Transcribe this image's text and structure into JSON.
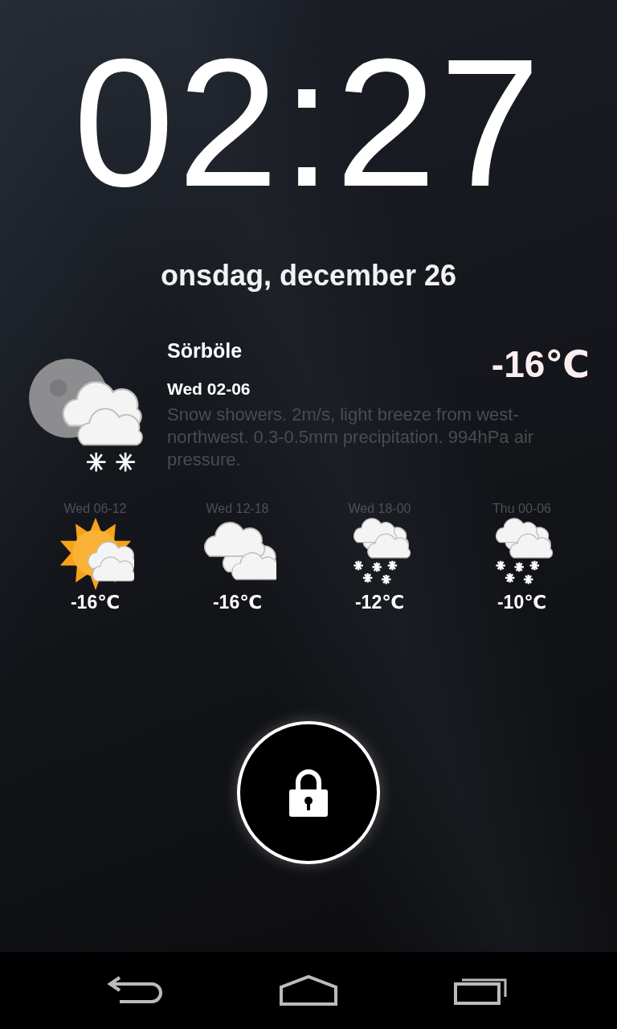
{
  "clock": {
    "time": "02:27"
  },
  "date": "onsdag, december 26",
  "current": {
    "kind": "moon-snow",
    "location": "Sörböle",
    "temperature": "-16℃",
    "period": "Wed 02-06",
    "description": "Snow showers. 2m/s, light breeze from west-northwest. 0.3-0.5mm precipitation. 994hPa air pressure."
  },
  "forecast": [
    {
      "period": "Wed 06-12",
      "kind": "sun-cloud",
      "temperature": "-16℃"
    },
    {
      "period": "Wed 12-18",
      "kind": "clouds",
      "temperature": "-16℃"
    },
    {
      "period": "Wed 18-00",
      "kind": "snow",
      "temperature": "-12℃"
    },
    {
      "period": "Thu 00-06",
      "kind": "snow",
      "temperature": "-10℃"
    }
  ]
}
